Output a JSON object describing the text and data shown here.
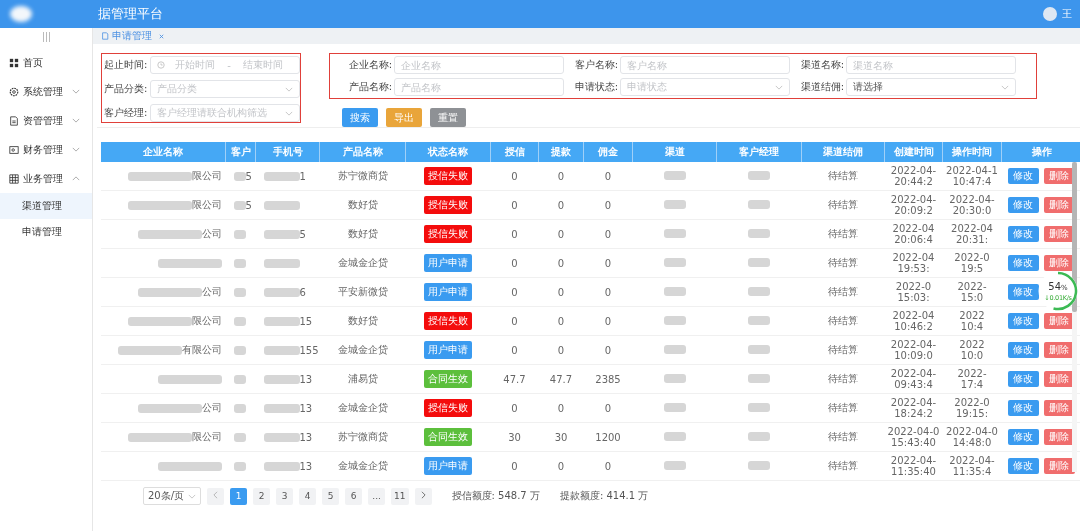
{
  "header": {
    "title": "据管理平台",
    "user": "王"
  },
  "sidebar": {
    "items": [
      {
        "label": "首页"
      },
      {
        "label": "系统管理",
        "expanded": false
      },
      {
        "label": "资管管理",
        "expanded": false
      },
      {
        "label": "财务管理",
        "expanded": false
      },
      {
        "label": "业务管理",
        "expanded": true,
        "children": [
          {
            "label": "渠道管理",
            "selected": true
          },
          {
            "label": "申请管理",
            "selected": false
          }
        ]
      }
    ]
  },
  "tabs": [
    {
      "label": "申请管理",
      "selected": true
    }
  ],
  "filters_left": [
    {
      "label": "起止时间:",
      "kind": "range",
      "start": "开始时间",
      "separator": "-",
      "end": "结束时间"
    },
    {
      "label": "产品分类:",
      "kind": "select",
      "placeholder": "产品分类"
    },
    {
      "label": "客户经理:",
      "kind": "select",
      "placeholder": "客户经理请联合机构筛选"
    }
  ],
  "filters_right": [
    {
      "label": "企业名称:",
      "kind": "input",
      "placeholder": "企业名称"
    },
    {
      "label": "客户名称:",
      "kind": "input",
      "placeholder": "客户名称"
    },
    {
      "label": "渠道名称:",
      "kind": "input",
      "placeholder": "渠道名称"
    },
    {
      "label": "产品名称:",
      "kind": "input",
      "placeholder": "产品名称"
    },
    {
      "label": "申请状态:",
      "kind": "select",
      "placeholder": "申请状态"
    },
    {
      "label": "渠道结佣:",
      "kind": "select",
      "value": "请选择"
    }
  ],
  "buttons": [
    {
      "label": "搜索",
      "kind": "primary"
    },
    {
      "label": "导出",
      "kind": "warning"
    },
    {
      "label": "重置",
      "kind": "info"
    }
  ],
  "table": {
    "columns": [
      "企业名称",
      "客户",
      "手机号",
      "产品名称",
      "状态名称",
      "授信",
      "提款",
      "佣金",
      "渠道",
      "客户经理",
      "渠道结佣",
      "创建时间",
      "操作时间",
      "操作"
    ],
    "rows": [
      {
        "company": {
          "text": "限公司",
          "redacted": true
        },
        "customer": {
          "text": "5",
          "redacted": true
        },
        "phone": {
          "text": "1",
          "redacted": true
        },
        "product": "苏宁微商贷",
        "status": {
          "label": "授信失败",
          "kind": "fail"
        },
        "credit": "0",
        "draw": "0",
        "commission": "0",
        "channel": {
          "redacted": true
        },
        "manager": {
          "redacted": true
        },
        "settle": "待结算",
        "created": [
          "2022-04-",
          "20:44:2"
        ],
        "operated": [
          "2022-04-1",
          "10:47:4"
        ],
        "actions": [
          {
            "label": "修改",
            "kind": "edit"
          },
          {
            "label": "删除",
            "kind": "delete"
          }
        ]
      },
      {
        "company": {
          "text": "限公司",
          "redacted": true
        },
        "customer": {
          "text": "5",
          "redacted": true
        },
        "phone": {
          "redacted": true
        },
        "product": "数好贷",
        "status": {
          "label": "授信失败",
          "kind": "fail"
        },
        "credit": "0",
        "draw": "0",
        "commission": "0",
        "channel": {
          "redacted": true
        },
        "manager": {
          "redacted": true
        },
        "settle": "待结算",
        "created": [
          "2022-04-",
          "20:09:2"
        ],
        "operated": [
          "2022-04-",
          "20:30:0"
        ],
        "actions": [
          {
            "label": "修改",
            "kind": "edit"
          },
          {
            "label": "删除",
            "kind": "delete"
          }
        ]
      },
      {
        "company": {
          "text": "公司",
          "redacted": true
        },
        "customer": {
          "redacted": true
        },
        "phone": {
          "text": "5",
          "redacted": true
        },
        "product": "数好贷",
        "status": {
          "label": "授信失败",
          "kind": "fail"
        },
        "credit": "0",
        "draw": "0",
        "commission": "0",
        "channel": {
          "redacted": true
        },
        "manager": {
          "redacted": true
        },
        "settle": "待结算",
        "created": [
          "2022-04",
          "20:06:4"
        ],
        "operated": [
          "2022-04",
          "20:31:"
        ],
        "actions": [
          {
            "label": "修改",
            "kind": "edit"
          },
          {
            "label": "删除",
            "kind": "delete"
          }
        ]
      },
      {
        "company": {
          "redacted": true
        },
        "customer": {
          "redacted": true
        },
        "phone": {
          "redacted": true
        },
        "product": "金城金企贷",
        "status": {
          "label": "用户申请",
          "kind": "apply"
        },
        "credit": "0",
        "draw": "0",
        "commission": "0",
        "channel": {
          "redacted": true
        },
        "manager": {
          "redacted": true
        },
        "settle": "待结算",
        "created": [
          "2022-04",
          "19:53:"
        ],
        "operated": [
          "2022-0",
          "19:5"
        ],
        "actions": [
          {
            "label": "修改",
            "kind": "edit"
          },
          {
            "label": "删除",
            "kind": "delete"
          }
        ]
      },
      {
        "company": {
          "text": "公司",
          "redacted": true
        },
        "customer": {
          "redacted": true
        },
        "phone": {
          "text": "6",
          "redacted": true
        },
        "product": "平安新微贷",
        "status": {
          "label": "用户申请",
          "kind": "apply"
        },
        "credit": "0",
        "draw": "0",
        "commission": "0",
        "channel": {
          "redacted": true
        },
        "manager": {
          "redacted": true
        },
        "settle": "待结算",
        "created": [
          "2022-0",
          "15:03:"
        ],
        "operated": [
          "2022-",
          "15:0"
        ],
        "actions": [
          {
            "label": "修改",
            "kind": "edit"
          },
          {
            "kind": "delete"
          }
        ]
      },
      {
        "company": {
          "text": "限公司",
          "redacted": true
        },
        "customer": {
          "redacted": true
        },
        "phone": {
          "text": "15",
          "redacted": true
        },
        "product": "数好贷",
        "status": {
          "label": "授信失败",
          "kind": "fail"
        },
        "credit": "0",
        "draw": "0",
        "commission": "0",
        "channel": {
          "redacted": true
        },
        "manager": {
          "redacted": true
        },
        "settle": "待结算",
        "created": [
          "2022-04",
          "10:46:2"
        ],
        "operated": [
          "2022",
          "10:4"
        ],
        "actions": [
          {
            "label": "修改",
            "kind": "edit"
          },
          {
            "label": "删除",
            "kind": "delete"
          }
        ]
      },
      {
        "company": {
          "text": "有限公司",
          "redacted": true
        },
        "customer": {
          "redacted": true
        },
        "phone": {
          "text": "155",
          "redacted": true
        },
        "product": "金城金企贷",
        "status": {
          "label": "用户申请",
          "kind": "apply"
        },
        "credit": "0",
        "draw": "0",
        "commission": "0",
        "channel": {
          "redacted": true
        },
        "manager": {
          "redacted": true
        },
        "settle": "待结算",
        "created": [
          "2022-04-",
          "10:09:0"
        ],
        "operated": [
          "2022",
          "10:0"
        ],
        "actions": [
          {
            "label": "修改",
            "kind": "edit"
          },
          {
            "label": "删除",
            "kind": "delete"
          }
        ]
      },
      {
        "company": {
          "redacted": true
        },
        "customer": {
          "redacted": true
        },
        "phone": {
          "text": "13",
          "redacted": true
        },
        "product": "浦易贷",
        "status": {
          "label": "合同生效",
          "kind": "ok"
        },
        "credit": "47.7",
        "draw": "47.7",
        "commission": "2385",
        "channel": {
          "redacted": true
        },
        "manager": {
          "redacted": true
        },
        "settle": "待结算",
        "created": [
          "2022-04-",
          "09:43:4"
        ],
        "operated": [
          "2022-",
          "17:4"
        ],
        "actions": [
          {
            "label": "修改",
            "kind": "edit"
          },
          {
            "label": "删除",
            "kind": "delete"
          }
        ]
      },
      {
        "company": {
          "text": "公司",
          "redacted": true
        },
        "customer": {
          "redacted": true
        },
        "phone": {
          "text": "13",
          "redacted": true
        },
        "product": "金城金企贷",
        "status": {
          "label": "授信失败",
          "kind": "fail"
        },
        "credit": "0",
        "draw": "0",
        "commission": "0",
        "channel": {
          "redacted": true
        },
        "manager": {
          "redacted": true
        },
        "settle": "待结算",
        "created": [
          "2022-04-",
          "18:24:2"
        ],
        "operated": [
          "2022-0",
          "19:15:"
        ],
        "actions": [
          {
            "label": "修改",
            "kind": "edit"
          },
          {
            "label": "删除",
            "kind": "delete"
          }
        ]
      },
      {
        "company": {
          "text": "限公司",
          "redacted": true
        },
        "customer": {
          "redacted": true
        },
        "phone": {
          "text": "13",
          "redacted": true
        },
        "product": "苏宁微商贷",
        "status": {
          "label": "合同生效",
          "kind": "ok"
        },
        "credit": "30",
        "draw": "30",
        "commission": "1200",
        "channel": {
          "redacted": true
        },
        "manager": {
          "redacted": true
        },
        "settle": "待结算",
        "created": [
          "2022-04-0",
          "15:43:40"
        ],
        "operated": [
          "2022-04-0",
          "14:48:0"
        ],
        "actions": [
          {
            "label": "修改",
            "kind": "edit"
          },
          {
            "label": "删除",
            "kind": "delete"
          }
        ]
      },
      {
        "company": {
          "redacted": true
        },
        "customer": {
          "redacted": true
        },
        "phone": {
          "text": "13",
          "redacted": true
        },
        "product": "金城金企贷",
        "status": {
          "label": "用户申请",
          "kind": "apply"
        },
        "credit": "0",
        "draw": "0",
        "commission": "0",
        "channel": {
          "redacted": true
        },
        "manager": {
          "redacted": true
        },
        "settle": "待结算",
        "created": [
          "2022-04-",
          "11:35:40"
        ],
        "operated": [
          "2022-04-",
          "11:35:4"
        ],
        "actions": [
          {
            "label": "修改",
            "kind": "edit"
          },
          {
            "label": "删除",
            "kind": "delete"
          }
        ]
      }
    ]
  },
  "pagination": {
    "page_size": "20条/页",
    "pages": [
      {
        "label": "1",
        "selected": true
      },
      {
        "label": "2",
        "selected": false
      },
      {
        "label": "3",
        "selected": false
      },
      {
        "label": "4",
        "selected": false
      },
      {
        "label": "5",
        "selected": false
      },
      {
        "label": "6",
        "selected": false
      },
      {
        "label": "...",
        "selected": false
      },
      {
        "label": "11",
        "selected": false
      }
    ]
  },
  "summary": [
    "授信额度: 548.7 万",
    "提款额度: 414.1 万"
  ],
  "speed_widget": {
    "percent": "54",
    "unit": "%",
    "rate": "↓0.01K/s",
    "level": 0.54
  }
}
